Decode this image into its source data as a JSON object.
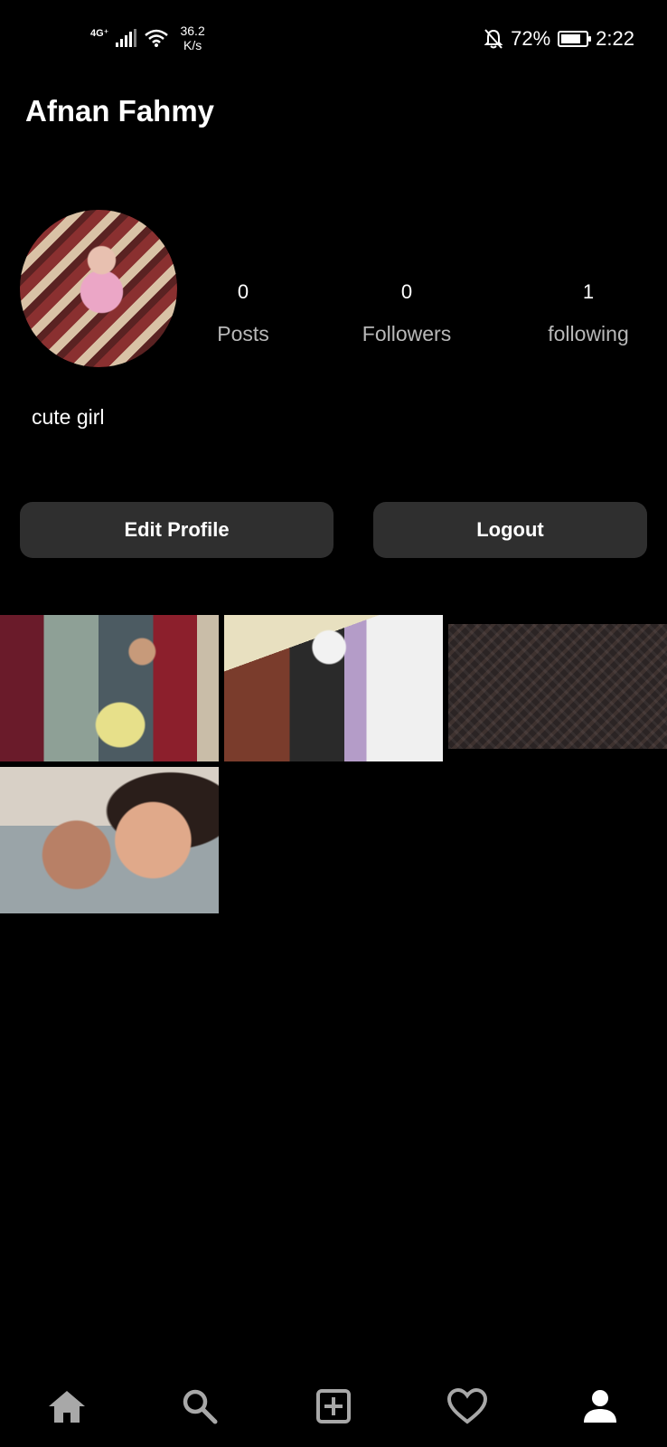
{
  "status_bar": {
    "network_type": "4G⁺",
    "speed_value": "36.2",
    "speed_unit": "K/s",
    "battery": "72%",
    "time": "2:22"
  },
  "profile": {
    "name": "Afnan Fahmy",
    "bio": "cute girl",
    "stats": [
      {
        "count": "0",
        "label": "Posts"
      },
      {
        "count": "0",
        "label": "Followers"
      },
      {
        "count": "1",
        "label": "following"
      }
    ]
  },
  "actions": {
    "edit_label": "Edit Profile",
    "logout_label": "Logout"
  },
  "posts": [
    {
      "icon": "photo"
    },
    {
      "icon": "photo"
    },
    {
      "icon": "photo"
    },
    {
      "icon": "photo"
    }
  ],
  "bottom_nav": {
    "items": [
      "home-icon",
      "search-icon",
      "add-post-icon",
      "heart-icon",
      "profile-icon"
    ],
    "active": "profile-icon",
    "colors": {
      "active": "#ffffff",
      "inactive": "#a8a8a8"
    }
  }
}
